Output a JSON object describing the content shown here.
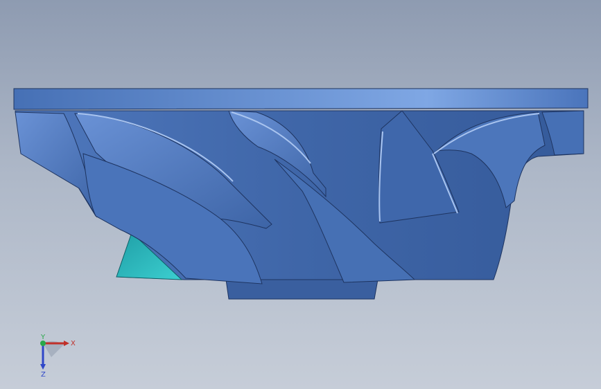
{
  "viewport": {
    "background_top": "#8e9bb1",
    "background_bottom": "#c6cdd8"
  },
  "model": {
    "name": "impeller",
    "body_color": "#4a72b5",
    "highlight_color": "#7fa3dd",
    "shadow_color": "#2d4f8a",
    "cross_section_color": "#22b2b6"
  },
  "triad": {
    "x_label": "X",
    "y_label": "Y",
    "z_label": "Z",
    "x_color": "#c0302a",
    "y_color": "#2aa84a",
    "z_color": "#2f47c8"
  }
}
